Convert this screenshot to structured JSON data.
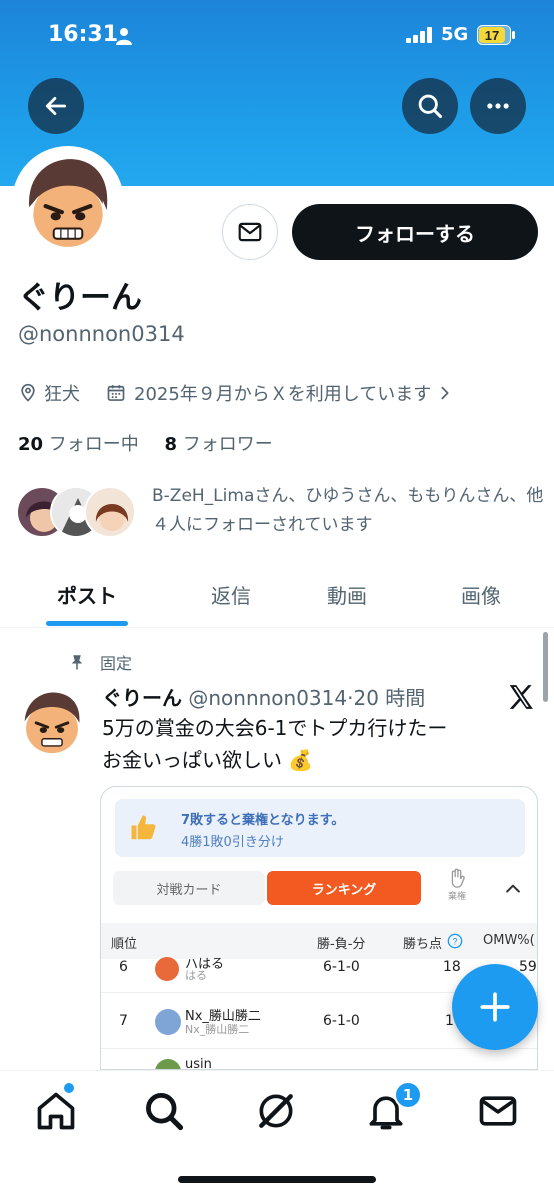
{
  "status_bar": {
    "time": "16:31",
    "network": "5G",
    "battery": "17"
  },
  "header": {
    "back_icon": "arrow-left-icon",
    "search_icon": "search-icon",
    "more_icon": "more-horizontal-icon"
  },
  "profile": {
    "display_name": "ぐりーん",
    "handle": "@nonnnon0314",
    "location": "狂犬",
    "joined": "2025年９月からＸを利用しています",
    "following_count": "20",
    "following_label": "フォロー中",
    "followers_count": "8",
    "followers_label": "フォロワー",
    "followed_by_text": "B-ZeH_Limaさん、ひゆうさん、ももりんさん、他４人にフォローされています",
    "follow_button": "フォローする"
  },
  "tabs": [
    {
      "label": "ポスト",
      "active": true
    },
    {
      "label": "返信",
      "active": false
    },
    {
      "label": "動画",
      "active": false
    },
    {
      "label": "画像",
      "active": false
    }
  ],
  "post": {
    "pinned_label": "固定",
    "author_name": "ぐりーん",
    "author_handle": "@nonnnon0314",
    "separator": "·",
    "time": "20 時間",
    "line1": "5万の賞金の大会6-1でトプカ行けたー",
    "line2": "お金いっぱい欲しい",
    "emoji": "💰"
  },
  "embed": {
    "notice_title": "7敗すると棄権となります。",
    "notice_sub": "4勝1敗0引き分け",
    "seg_cards": "対戦カード",
    "seg_ranking": "ランキング",
    "withdraw_label": "棄権",
    "columns": [
      "順位",
      "勝-負-分",
      "勝ち点",
      "OMW%("
    ],
    "rows": [
      {
        "rank": "6",
        "name": "ハはる",
        "sub": "はる",
        "record": "6-1-0",
        "points": "18",
        "omw": "59"
      },
      {
        "rank": "7",
        "name": "Nx_勝山勝二",
        "sub": "Nx_勝山勝二",
        "record": "6-1-0",
        "points": "1",
        "omw": ""
      },
      {
        "rank": "",
        "name": "usin",
        "sub": "",
        "record": "",
        "points": "",
        "omw": ""
      }
    ]
  },
  "bottom_nav": {
    "notifications_badge": "1"
  },
  "colors": {
    "accent": "#1d9bf0",
    "banner": "#1e9ce8",
    "ranking": "#f25a22"
  }
}
